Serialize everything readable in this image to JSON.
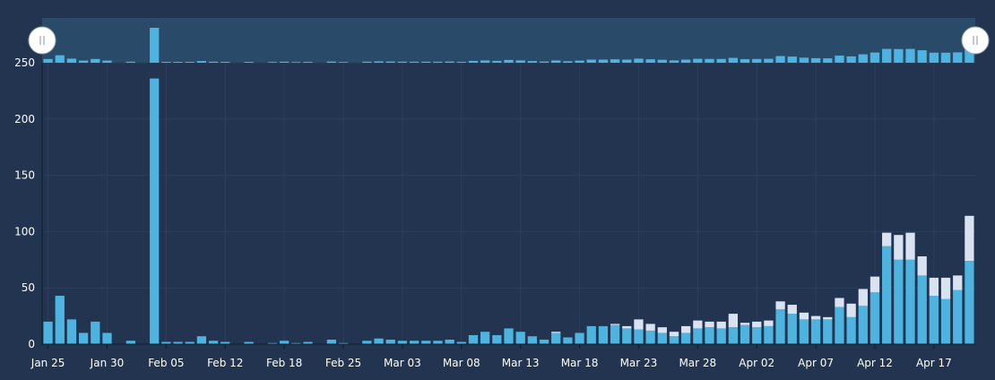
{
  "colors": {
    "background": "#22344f",
    "plot_background": "#22344f",
    "navigator_background": "#2a4a69",
    "grid": "#2c3f5c",
    "axis_text": "#ffffff",
    "series_primary": "#4fb3df",
    "series_secondary": "#d9e2f1",
    "handle_fill": "#ffffff",
    "handle_stroke": "#9aa7b8"
  },
  "navigator": {
    "left_handle_icon": "grip-handle-icon",
    "right_handle_icon": "grip-handle-icon"
  },
  "chart_data": {
    "type": "bar",
    "stacked": true,
    "grid": true,
    "legend": "none",
    "ylim": [
      0,
      250
    ],
    "yticks": [
      0,
      50,
      100,
      150,
      200,
      250
    ],
    "x_tick_labels": [
      "Jan 25",
      "Jan 30",
      "Feb 05",
      "Feb 12",
      "Feb 18",
      "Feb 25",
      "Mar 03",
      "Mar 08",
      "Mar 13",
      "Mar 18",
      "Mar 23",
      "Mar 28",
      "Apr 02",
      "Apr 07",
      "Apr 12",
      "Apr 17"
    ],
    "x_tick_index": [
      0,
      5,
      10,
      15,
      20,
      25,
      30,
      35,
      40,
      45,
      50,
      55,
      60,
      65,
      70,
      75
    ],
    "series": [
      {
        "values": [
          20,
          43,
          22,
          10,
          20,
          10,
          0,
          3,
          0,
          236,
          2,
          2,
          2,
          7,
          3,
          2,
          0,
          2,
          0,
          1,
          3,
          1,
          2,
          0,
          4,
          1,
          0,
          3,
          5,
          4,
          3,
          3,
          3,
          3,
          4,
          2,
          8,
          11,
          8,
          14,
          11,
          7,
          4,
          10,
          6,
          10,
          16,
          16,
          17,
          14,
          13,
          12,
          10,
          7,
          10,
          14,
          15,
          14,
          15,
          17,
          15,
          16,
          31,
          27,
          22,
          22,
          22,
          33,
          24,
          34,
          46,
          87,
          75,
          75,
          61,
          43,
          40,
          48,
          74
        ],
        "color": "#4fb3df"
      },
      {
        "values": [
          0,
          0,
          0,
          0,
          0,
          0,
          0,
          0,
          0,
          0,
          0,
          0,
          0,
          0,
          0,
          0,
          0,
          0,
          0,
          0,
          0,
          0,
          0,
          0,
          0,
          0,
          0,
          0,
          0,
          0,
          0,
          0,
          0,
          0,
          0,
          0,
          0,
          0,
          0,
          0,
          0,
          0,
          0,
          1,
          0,
          0,
          0,
          0,
          1,
          2,
          9,
          6,
          5,
          4,
          6,
          7,
          5,
          6,
          12,
          2,
          5,
          5,
          7,
          8,
          6,
          3,
          2,
          8,
          12,
          15,
          14,
          12,
          22,
          24,
          17,
          16,
          19,
          13,
          40
        ],
        "color": "#d9e2f1"
      }
    ]
  }
}
